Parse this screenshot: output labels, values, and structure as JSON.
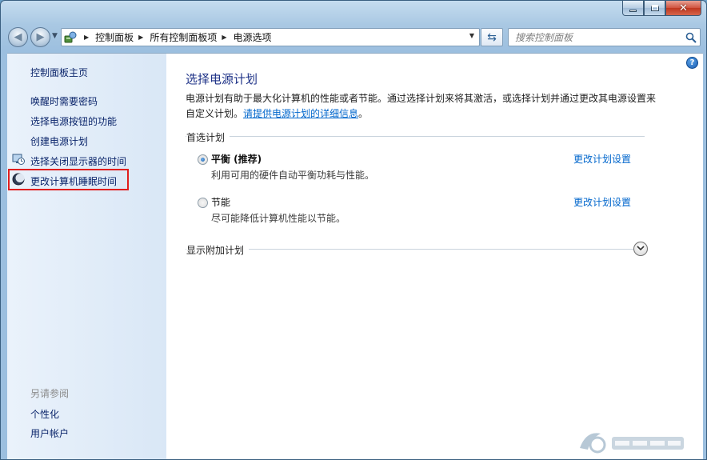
{
  "window": {
    "caption_buttons": [
      "minimize",
      "maximize",
      "close"
    ]
  },
  "navbar": {
    "breadcrumbs": [
      "控制面板",
      "所有控制面板项",
      "电源选项"
    ],
    "search_placeholder": "搜索控制面板"
  },
  "sidebar": {
    "home": "控制面板主页",
    "links": [
      {
        "label": "唤醒时需要密码",
        "icon": null
      },
      {
        "label": "选择电源按钮的功能",
        "icon": null
      },
      {
        "label": "创建电源计划",
        "icon": null
      },
      {
        "label": "选择关闭显示器的时间",
        "icon": "monitor-clock-icon"
      },
      {
        "label": "更改计算机睡眠时间",
        "icon": "moon-icon"
      }
    ],
    "see_also_header": "另请参阅",
    "see_also": [
      "个性化",
      "用户帐户"
    ]
  },
  "main": {
    "title": "选择电源计划",
    "description": "电源计划有助于最大化计算机的性能或者节能。通过选择计划来将其激活，或选择计划并通过更改其电源设置来自定义计划。",
    "description_link": "请提供电源计划的详细信息",
    "description_end": "。",
    "preferred_group": "首选计划",
    "plans": [
      {
        "name": "平衡 (推荐)",
        "desc": "利用可用的硬件自动平衡功耗与性能。",
        "link": "更改计划设置",
        "selected": true
      },
      {
        "name": "节能",
        "desc": "尽可能降低计算机性能以节能。",
        "link": "更改计划设置",
        "selected": false
      }
    ],
    "extra_group": "显示附加计划"
  },
  "colors": {
    "link": "#0066cc",
    "title": "#1e3287",
    "highlight": "#e01e1e"
  }
}
